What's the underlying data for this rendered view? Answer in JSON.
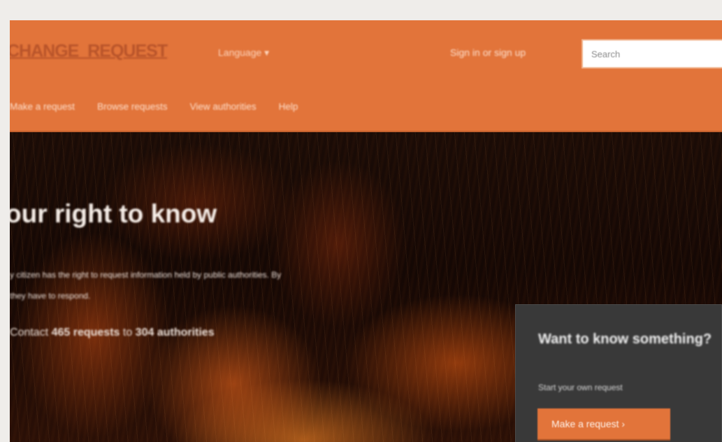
{
  "header": {
    "logo_text": "CHANGE_REQUEST",
    "language_label": "Language ▾",
    "signin_label": "Sign in or sign up",
    "search_placeholder": "Search"
  },
  "nav": {
    "items": [
      "Make a request",
      "Browse requests",
      "View authorities",
      "Help"
    ]
  },
  "hero": {
    "title": "our right to know",
    "description_line1": "y citizen has the right to request information held by public authorities. By",
    "description_line2": "they have to respond.",
    "stats_prefix": "Contact ",
    "stats_requests": "465 requests",
    "stats_middle": " to ",
    "stats_authorities": "304 authorities"
  },
  "cta": {
    "title": "Want to know something?",
    "subtitle": "Start your own request",
    "button_label": "Make a request ›"
  },
  "colors": {
    "accent": "#e2743a",
    "panel": "#393939",
    "page_background": "#efedea"
  }
}
